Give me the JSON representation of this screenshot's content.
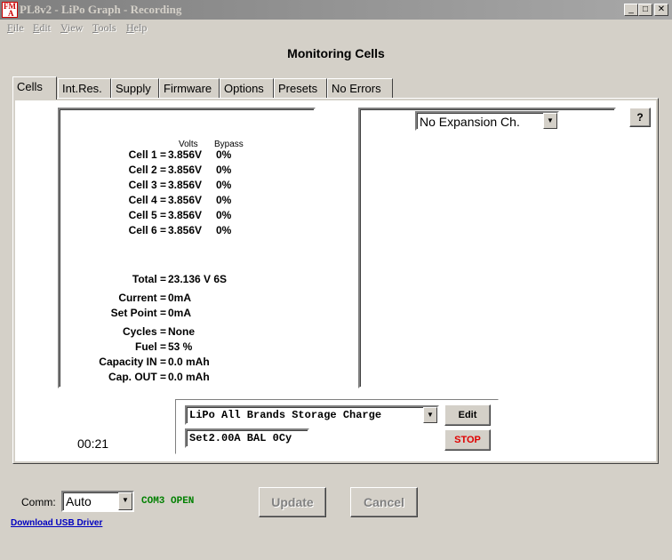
{
  "window": {
    "icon_text_top": "FM",
    "icon_text_bottom": "A",
    "title": "PL8v2 - LiPo Graph - Recording",
    "min_glyph": "_",
    "max_glyph": "□",
    "close_glyph": "✕"
  },
  "menu": [
    "File",
    "Edit",
    "View",
    "Tools",
    "Help"
  ],
  "page_title": "Monitoring Cells",
  "tabs": [
    "Cells",
    "Int.Res.",
    "Supply",
    "Firmware",
    "Options",
    "Presets",
    "No Errors"
  ],
  "cells_panel": {
    "header_volts": "Volts",
    "header_bypass": "Bypass",
    "cells": [
      {
        "label": "Cell 1 =",
        "volts": "3.856V",
        "bypass": "0%"
      },
      {
        "label": "Cell 2 =",
        "volts": "3.856V",
        "bypass": "0%"
      },
      {
        "label": "Cell 3 =",
        "volts": "3.856V",
        "bypass": "0%"
      },
      {
        "label": "Cell 4 =",
        "volts": "3.856V",
        "bypass": "0%"
      },
      {
        "label": "Cell 5 =",
        "volts": "3.856V",
        "bypass": "0%"
      },
      {
        "label": "Cell 6 =",
        "volts": "3.856V",
        "bypass": "0%"
      }
    ],
    "total_label": "Total =",
    "total_value": "23.136 V  6S",
    "stats": [
      {
        "label": "Current =",
        "value": "0mA"
      },
      {
        "label": "Set Point =",
        "value": "0mA"
      },
      {
        "label": "Cycles =",
        "value": "None"
      },
      {
        "label": "Fuel =",
        "value": "53 %"
      },
      {
        "label": "Capacity IN =",
        "value": "0.0 mAh"
      },
      {
        "label": "Cap. OUT =",
        "value": "0.0 mAh"
      }
    ]
  },
  "expansion": {
    "selected": "No Expansion Ch."
  },
  "help_button": "?",
  "charge": {
    "preset": "LiPo All Brands Storage Charge",
    "status": "Set2.00A BAL 0Cy",
    "edit_label": "Edit",
    "stop_label": "STOP",
    "stop_color": "#e00000"
  },
  "timer": "00:21",
  "comm": {
    "label": "Comm:",
    "selected": "Auto",
    "status": "COM3 OPEN",
    "status_color": "#008000"
  },
  "usb_link": "Download USB Driver",
  "update_label": "Update",
  "cancel_label": "Cancel",
  "arrow_glyph": "▼"
}
